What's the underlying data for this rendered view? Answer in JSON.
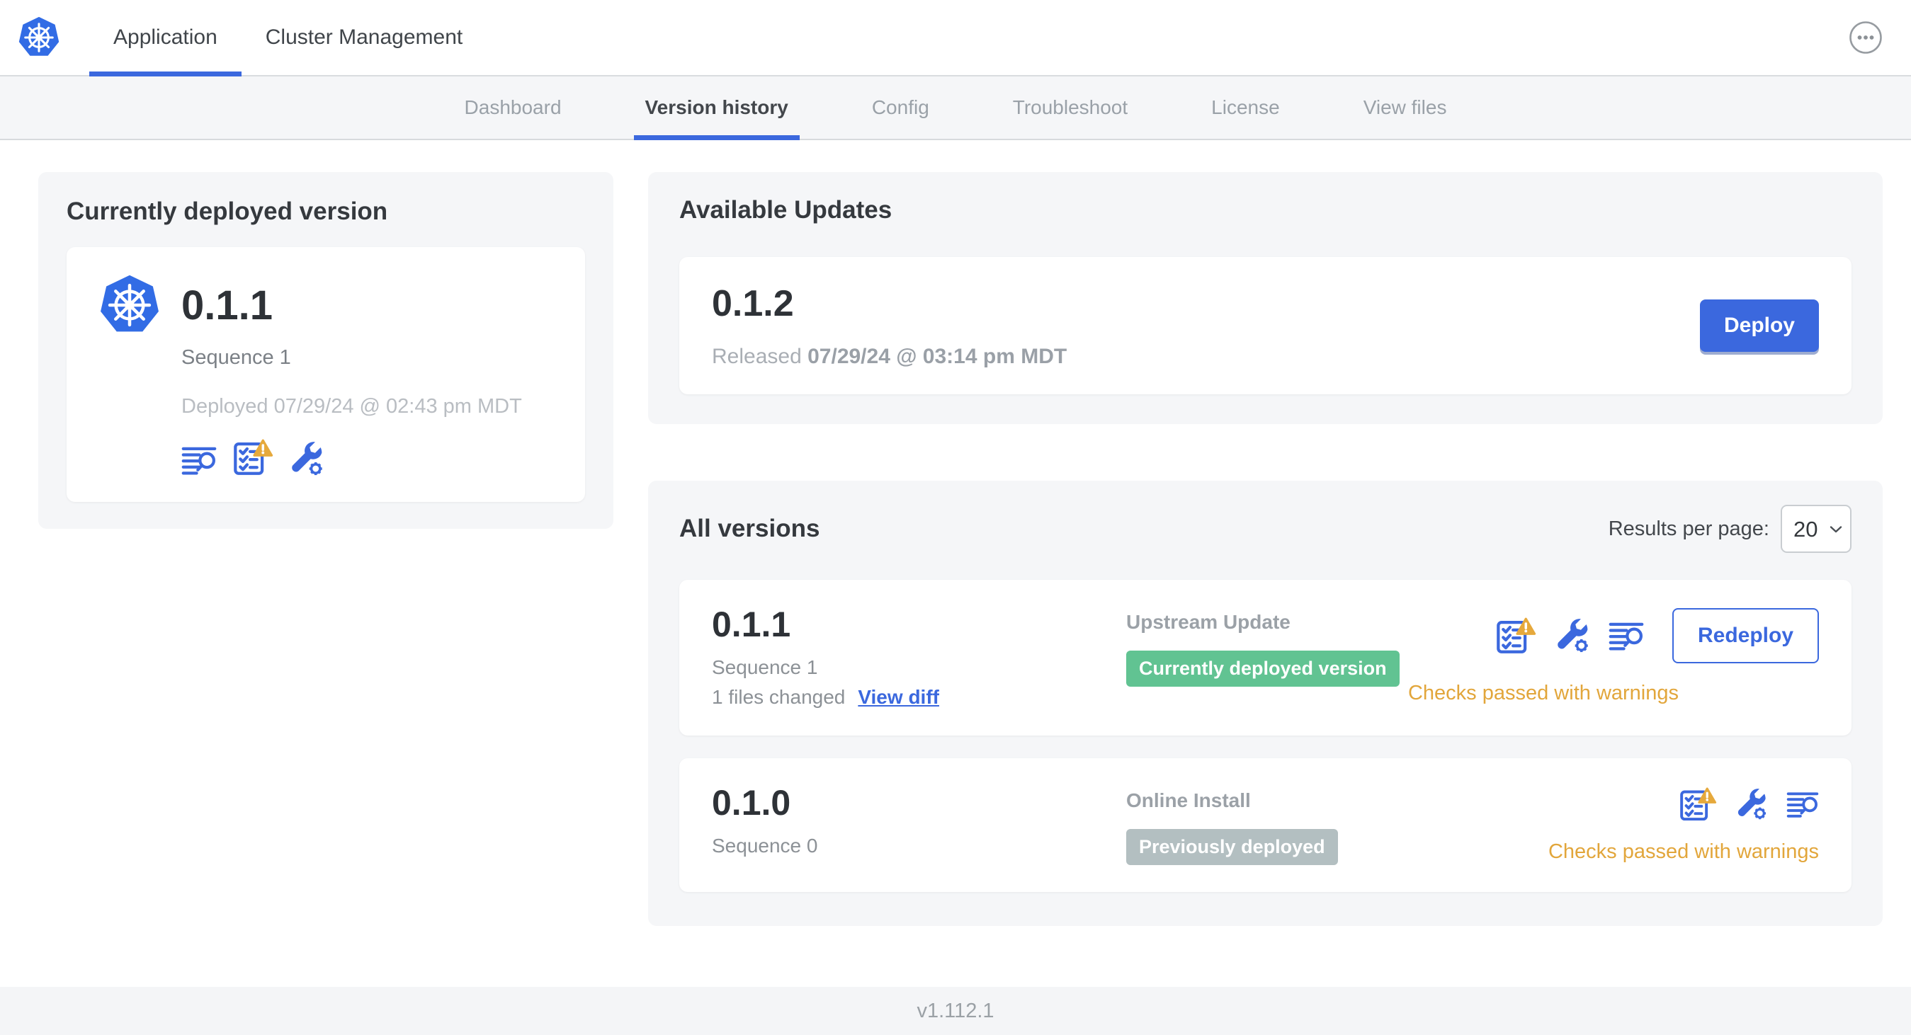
{
  "header": {
    "tabs": [
      {
        "label": "Application",
        "active": true
      },
      {
        "label": "Cluster Management",
        "active": false
      }
    ],
    "more_menu": "more-options"
  },
  "subnav": {
    "tabs": [
      {
        "label": "Dashboard",
        "active": false
      },
      {
        "label": "Version history",
        "active": true
      },
      {
        "label": "Config",
        "active": false
      },
      {
        "label": "Troubleshoot",
        "active": false
      },
      {
        "label": "License",
        "active": false
      },
      {
        "label": "View files",
        "active": false
      }
    ]
  },
  "current_version": {
    "title": "Currently deployed version",
    "version": "0.1.1",
    "sequence": "Sequence 1",
    "deployed": "Deployed 07/29/24 @ 02:43 pm MDT",
    "icons": [
      "view-logs-icon",
      "preflight-checks-warning-icon",
      "edit-config-icon"
    ]
  },
  "available_updates": {
    "title": "Available Updates",
    "version": "0.1.2",
    "released_prefix": "Released",
    "released_date": "07/29/24 @ 03:14 pm MDT",
    "deploy_label": "Deploy"
  },
  "all_versions": {
    "title": "All versions",
    "results_per_page_label": "Results per page:",
    "results_per_page_value": "20",
    "rows": [
      {
        "version": "0.1.1",
        "sequence": "Sequence 1",
        "files_changed": "1 files changed",
        "view_diff_label": "View diff",
        "source": "Upstream Update",
        "badge": {
          "label": "Currently deployed version",
          "color": "#61c392"
        },
        "icons": [
          "preflight-checks-warning-icon",
          "edit-config-icon",
          "view-logs-icon"
        ],
        "action_label": "Redeploy",
        "status": "Checks passed with warnings"
      },
      {
        "version": "0.1.0",
        "sequence": "Sequence 0",
        "source": "Online Install",
        "badge": {
          "label": "Previously deployed",
          "color": "#b3bfc1"
        },
        "icons": [
          "preflight-checks-warning-icon",
          "edit-config-icon",
          "view-logs-icon"
        ],
        "status": "Checks passed with warnings"
      }
    ]
  },
  "footer": {
    "app_version": "v1.112.1"
  },
  "colors": {
    "accent_blue": "#3b68de",
    "k8s_blue": "#326ce5",
    "success_green": "#61c392",
    "muted_badge_gray": "#b3bfc1",
    "warning_amber": "#e6a93c",
    "warning_text": "#e2a63b"
  }
}
